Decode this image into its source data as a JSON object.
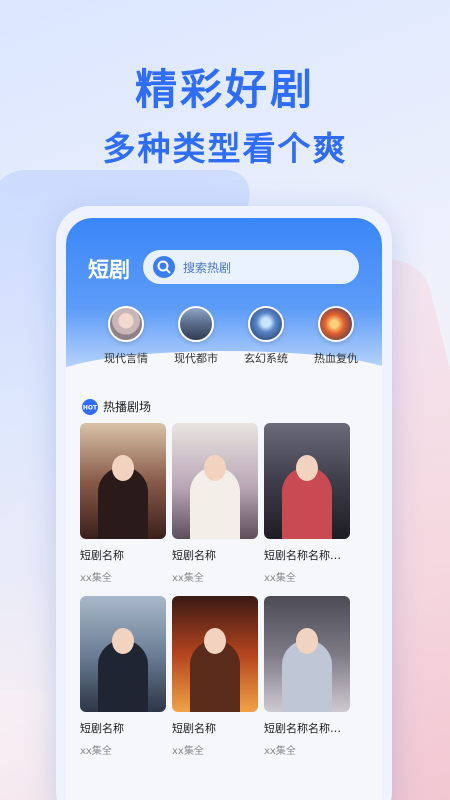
{
  "hero": {
    "title": "精彩好剧",
    "subtitle": "多种类型看个爽"
  },
  "app": {
    "brand": "短剧",
    "search_placeholder": "搜索热剧"
  },
  "categories": [
    {
      "label": "现代言情",
      "icon": "romance-avatar"
    },
    {
      "label": "现代都市",
      "icon": "city-avatar"
    },
    {
      "label": "玄幻系统",
      "icon": "fantasy-avatar"
    },
    {
      "label": "热血复仇",
      "icon": "revenge-avatar"
    }
  ],
  "section": {
    "title": "热播剧场",
    "icon": "hot-icon"
  },
  "dramas": [
    {
      "title": "短剧名称",
      "meta": "xx集全"
    },
    {
      "title": "短剧名称",
      "meta": "xx集全"
    },
    {
      "title": "短剧名称名称名...",
      "meta": "xx集全"
    },
    {
      "title": "短剧名称",
      "meta": "xx集全"
    },
    {
      "title": "短剧名称",
      "meta": "xx集全"
    },
    {
      "title": "短剧名称名称名...",
      "meta": "xx集全"
    }
  ],
  "colors": {
    "accent": "#2f6df5",
    "header_top": "#3a86f7"
  }
}
